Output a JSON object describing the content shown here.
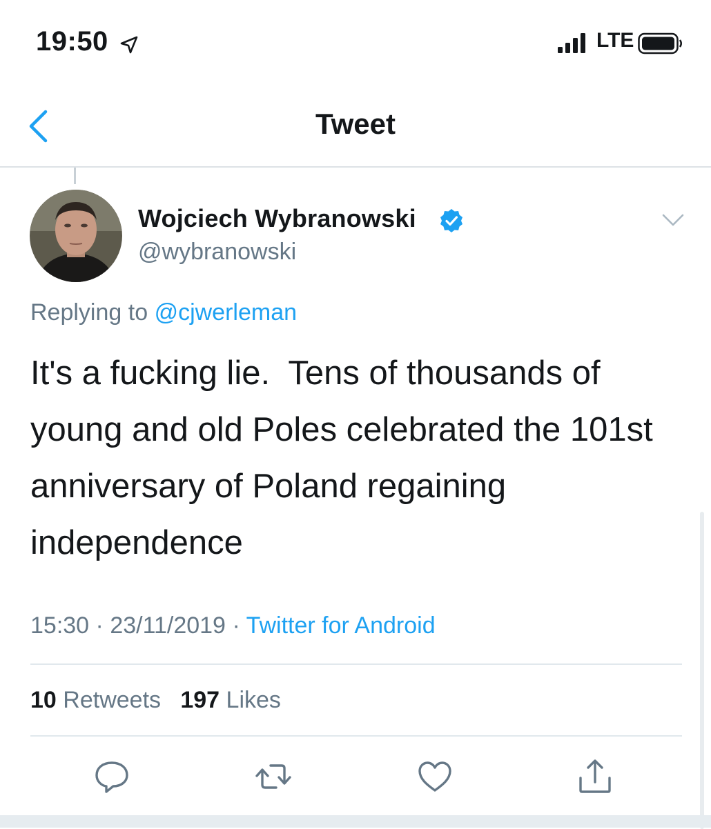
{
  "status_bar": {
    "time": "19:50",
    "network": "LTE",
    "icons": [
      "location-arrow-icon",
      "signal-icon",
      "battery-icon"
    ]
  },
  "nav": {
    "title": "Tweet",
    "back_icon": "chevron-left-icon"
  },
  "tweet": {
    "author_name": "Wojciech Wybranowski",
    "handle": "@wybranowski",
    "verified": true,
    "replying_prefix": "Replying to",
    "replying_to": "@cjwerleman",
    "text": "It's a fucking lie.  Tens of thousands of young and old Poles celebrated the 101st anniversary of Poland regaining independence",
    "time": "15:30",
    "date": "23/11/2019",
    "separator": "·",
    "source": "Twitter for Android"
  },
  "stats": {
    "retweets_count": "10",
    "retweets_label": "Retweets",
    "likes_count": "197",
    "likes_label": "Likes"
  },
  "actions": [
    "reply-icon",
    "retweet-icon",
    "like-icon",
    "share-icon"
  ],
  "colors": {
    "accent": "#1da1f2",
    "text_primary": "#14171a",
    "text_secondary": "#657786",
    "divider": "#e1e8ed"
  }
}
